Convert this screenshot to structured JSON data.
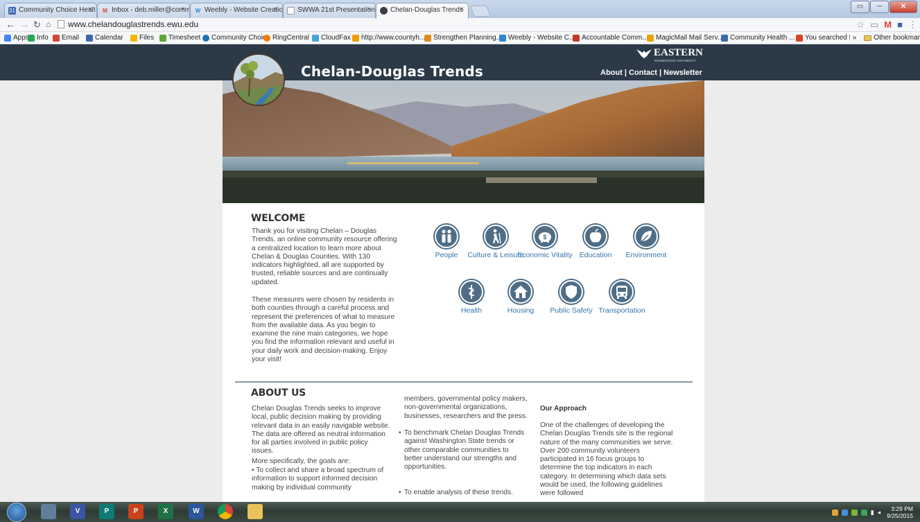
{
  "browser": {
    "tabs": [
      {
        "label": "Community Choice Healt",
        "fav_color": "#3a68b0",
        "fav_glyph": "31"
      },
      {
        "label": "Inbox - deb.miller@comm",
        "fav_color": "#ffffff",
        "fav_glyph": "M"
      },
      {
        "label": "Weebly - Website Creatio",
        "fav_color": "#ffffff",
        "fav_glyph": "W"
      },
      {
        "label": "SWWA 21st Presentation",
        "fav_color": "#ffffff",
        "fav_glyph": ""
      },
      {
        "label": "Chelan-Douglas Trends",
        "fav_color": "#3b3f44",
        "fav_glyph": "",
        "active": true
      }
    ],
    "url": "www.chelandouglastrends.ewu.edu",
    "bookmarks": [
      {
        "label": "Apps",
        "icon": "apps-grid-icon",
        "color": "#4285f4"
      },
      {
        "label": "Info",
        "icon": "sheet-icon",
        "color": "#2aa653"
      },
      {
        "label": "Email",
        "icon": "gmail-icon",
        "color": "#d44638"
      },
      {
        "label": "Calendar",
        "icon": "calendar-icon",
        "color": "#3a68b0"
      },
      {
        "label": "Files",
        "icon": "drive-icon",
        "color": "#f4b400"
      },
      {
        "label": "Timesheet",
        "icon": "leaf-icon",
        "color": "#5ca832"
      },
      {
        "label": "Community Choice",
        "icon": "gear-icon",
        "color": "#1f6fb3"
      },
      {
        "label": "RingCentral",
        "icon": "ringcentral-icon",
        "color": "#f57c00"
      },
      {
        "label": "CloudFax",
        "icon": "cloudfax-icon",
        "color": "#4aa3df"
      },
      {
        "label": "http://www.countyh...",
        "icon": "bars-icon",
        "color": "#f29b00"
      },
      {
        "label": "Strengthen Planning...",
        "icon": "people-icon",
        "color": "#e08a1e"
      },
      {
        "label": "Weebly - Website C...",
        "icon": "weebly-icon",
        "color": "#2a87d6"
      },
      {
        "label": "Accountable Comm...",
        "icon": "pdf-icon",
        "color": "#c53929"
      },
      {
        "label": "MagicMail Mail Serv...",
        "icon": "mail-icon",
        "color": "#e9a400"
      },
      {
        "label": "Community Health ...",
        "icon": "doc-icon",
        "color": "#3a68b0"
      },
      {
        "label": "You searched for m...",
        "icon": "search-result-icon",
        "color": "#d9432b"
      }
    ],
    "more_bookmarks": "»",
    "other_bookmarks": "Other bookmar",
    "window_buttons": {
      "minimize": "▭",
      "maximize": "─",
      "close": "✕"
    }
  },
  "site": {
    "title": "Chelan-Douglas Trends",
    "university": "EASTERN",
    "university_sub": "WASHINGTON UNIVERSITY",
    "nav": {
      "about": "About",
      "contact": "Contact",
      "newsletter": "Newsletter",
      "sep": "|"
    }
  },
  "welcome": {
    "heading": "WELCOME",
    "paragraph1": "Thank you for visiting Chelan – Douglas Trends, an online community resource offering a centralized location to learn more about Chelan & Douglas Counties. With 130 indicators highlighted, all are supported by trusted, reliable sources and are continually updated.",
    "paragraph2": "These measures were chosen by residents in both counties through a careful process and represent the preferences of what to measure from the available data. As you begin to examine the nine main categories, we hope you find the information relevant and useful in your daily work and decision-making. Enjoy your visit!"
  },
  "categories": [
    {
      "label": "People",
      "icon": "people-icon"
    },
    {
      "label": "Culture & Leisure",
      "icon": "hiker-icon"
    },
    {
      "label": "Economic Vitality",
      "icon": "piggy-bank-icon"
    },
    {
      "label": "Education",
      "icon": "apple-icon"
    },
    {
      "label": "Environment",
      "icon": "leaf-icon"
    },
    {
      "label": "Health",
      "icon": "caduceus-icon"
    },
    {
      "label": "Housing",
      "icon": "house-icon"
    },
    {
      "label": "Public Safety",
      "icon": "badge-icon"
    },
    {
      "label": "Transportation",
      "icon": "bus-icon"
    }
  ],
  "about": {
    "heading": "ABOUT US",
    "col1_p1": "Chelan Douglas Trends seeks to improve local, public decision making by providing relevant data in an easily navigable website. The data are offered as neutral information for all parties involved in public policy issues.",
    "col1_p2": "More specifically, the goals are:",
    "col1_bullet": "• To collect and share a broad spectrum of information to support informed decision making by individual community",
    "col2_p1": "members, governmental policy makers, non-governmental organizations, businesses, researchers and the press.",
    "col2_b1": "To benchmark Chelan Douglas Trends against Washington State trends or other comparable communities to better understand our strengths and opportunities.",
    "col2_b2": "To enable analysis of these trends.",
    "col3_heading": "Our Approach",
    "col3_p1": "One of the challenges of developing the Chelan Douglas Trends site is the regional nature of the many communities we serve. Over 200 community volunteers participated in 16 focus groups to determine the top indicators in each category. In determining which data sets would be used, the following guidelines were followed"
  },
  "taskbar": {
    "apps": [
      {
        "name": "file-icon",
        "glyph": "",
        "color": "#5f7f9c"
      },
      {
        "name": "visio-icon",
        "glyph": "V",
        "color": "#3955a3"
      },
      {
        "name": "publisher-icon",
        "glyph": "P",
        "color": "#0f7b76"
      },
      {
        "name": "powerpoint-icon",
        "glyph": "P",
        "color": "#c8431b"
      },
      {
        "name": "excel-icon",
        "glyph": "X",
        "color": "#1f7244"
      },
      {
        "name": "word-icon",
        "glyph": "W",
        "color": "#2b579a"
      },
      {
        "name": "chrome-icon",
        "glyph": "",
        "color": "#db4437"
      },
      {
        "name": "explorer-icon",
        "glyph": "",
        "color": "#e8c25a"
      }
    ],
    "time": "3:29 PM",
    "date": "9/25/2015"
  }
}
